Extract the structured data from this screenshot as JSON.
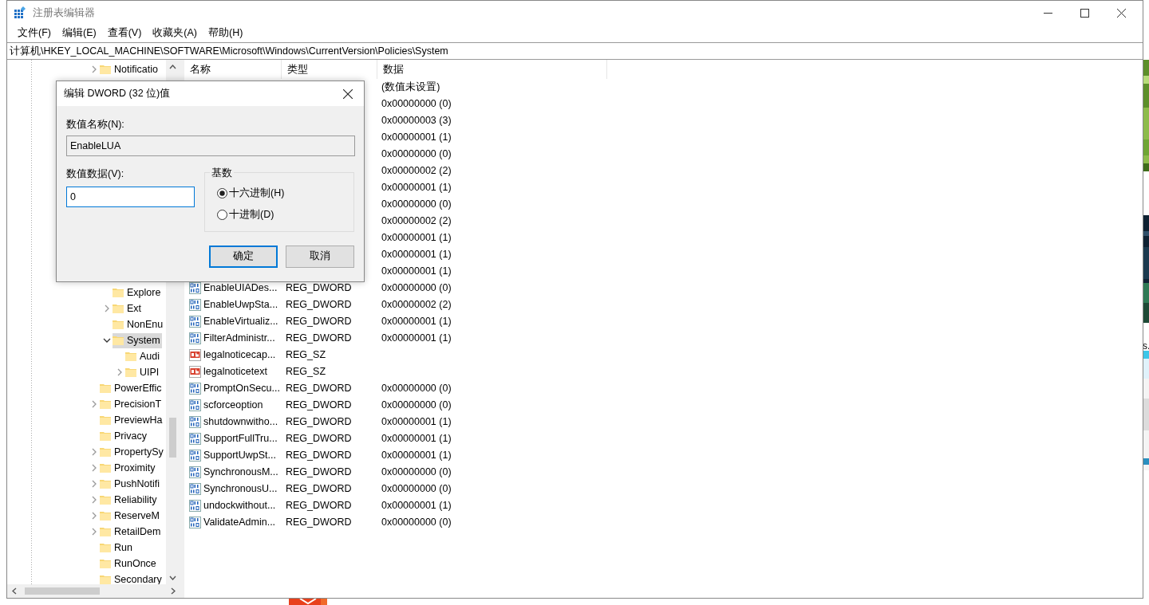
{
  "window": {
    "title": "注册表编辑器"
  },
  "menu": [
    "文件(F)",
    "编辑(E)",
    "查看(V)",
    "收藏夹(A)",
    "帮助(H)"
  ],
  "address": "计算机\\HKEY_LOCAL_MACHINE\\SOFTWARE\\Microsoft\\Windows\\CurrentVersion\\Policies\\System",
  "tree": [
    {
      "label": "Notificatio",
      "expanded": false,
      "selected": false
    },
    {
      "children": [
        {
          "label": "Explore",
          "selected": false
        },
        {
          "label": "Ext",
          "expanded": false,
          "selected": false
        },
        {
          "label": "NonEnu",
          "selected": false
        },
        {
          "label": "System",
          "expanded": true,
          "selected": true,
          "children": [
            {
              "label": "Audi",
              "selected": false
            },
            {
              "label": "UIPI",
              "expanded": false,
              "selected": false
            }
          ]
        }
      ]
    },
    {
      "label": "PowerEffic",
      "selected": false
    },
    {
      "label": "PrecisionT",
      "expanded": false,
      "selected": false
    },
    {
      "label": "PreviewHa",
      "selected": false
    },
    {
      "label": "Privacy",
      "selected": false
    },
    {
      "label": "PropertySy",
      "expanded": false,
      "selected": false
    },
    {
      "label": "Proximity",
      "expanded": false,
      "selected": false
    },
    {
      "label": "PushNotifi",
      "expanded": false,
      "selected": false
    },
    {
      "label": "Reliability",
      "expanded": false,
      "selected": false
    },
    {
      "label": "ReserveM",
      "expanded": false,
      "selected": false
    },
    {
      "label": "RetailDem",
      "expanded": false,
      "selected": false
    },
    {
      "label": "Run",
      "selected": false
    },
    {
      "label": "RunOnce",
      "selected": false
    },
    {
      "label": "Secondary",
      "selected": false
    }
  ],
  "columns": [
    "名称",
    "类型",
    "数据"
  ],
  "rows": [
    {
      "data": "(数值未设置)"
    },
    {
      "data": "0x00000000 (0)"
    },
    {
      "data": "0x00000003 (3)"
    },
    {
      "data": "0x00000001 (1)"
    },
    {
      "data": "0x00000000 (0)"
    },
    {
      "data": "0x00000002 (2)"
    },
    {
      "data": "0x00000001 (1)"
    },
    {
      "data": "0x00000000 (0)"
    },
    {
      "data": "0x00000002 (2)"
    },
    {
      "data": "0x00000001 (1)"
    },
    {
      "data": "0x00000001 (1)"
    },
    {
      "data": "0x00000001 (1)"
    },
    {
      "kind": "dword",
      "name": "EnableUIADes...",
      "type": "REG_DWORD",
      "data": "0x00000000 (0)"
    },
    {
      "kind": "dword",
      "name": "EnableUwpSta...",
      "type": "REG_DWORD",
      "data": "0x00000002 (2)"
    },
    {
      "kind": "dword",
      "name": "EnableVirtualiz...",
      "type": "REG_DWORD",
      "data": "0x00000001 (1)"
    },
    {
      "kind": "dword",
      "name": "FilterAdministr...",
      "type": "REG_DWORD",
      "data": "0x00000001 (1)"
    },
    {
      "kind": "sz",
      "name": "legalnoticecap...",
      "type": "REG_SZ"
    },
    {
      "kind": "sz",
      "name": "legalnoticetext",
      "type": "REG_SZ"
    },
    {
      "kind": "dword",
      "name": "PromptOnSecu...",
      "type": "REG_DWORD",
      "data": "0x00000000 (0)"
    },
    {
      "kind": "dword",
      "name": "scforceoption",
      "type": "REG_DWORD",
      "data": "0x00000000 (0)"
    },
    {
      "kind": "dword",
      "name": "shutdownwitho...",
      "type": "REG_DWORD",
      "data": "0x00000001 (1)"
    },
    {
      "kind": "dword",
      "name": "SupportFullTru...",
      "type": "REG_DWORD",
      "data": "0x00000001 (1)"
    },
    {
      "kind": "dword",
      "name": "SupportUwpSt...",
      "type": "REG_DWORD",
      "data": "0x00000001 (1)"
    },
    {
      "kind": "dword",
      "name": "SynchronousM...",
      "type": "REG_DWORD",
      "data": "0x00000000 (0)"
    },
    {
      "kind": "dword",
      "name": "SynchronousU...",
      "type": "REG_DWORD",
      "data": "0x00000000 (0)"
    },
    {
      "kind": "dword",
      "name": "undockwithout...",
      "type": "REG_DWORD",
      "data": "0x00000001 (1)"
    },
    {
      "kind": "dword",
      "name": "ValidateAdmin...",
      "type": "REG_DWORD",
      "data": "0x00000000 (0)"
    }
  ],
  "dialog": {
    "title": "编辑 DWORD (32 位)值",
    "name_label": "数值名称(N):",
    "name_value": "EnableLUA",
    "data_label": "数值数据(V):",
    "data_value": "0",
    "base_label": "基数",
    "bases": [
      {
        "label": "十六进制(H)",
        "selected": true
      },
      {
        "label": "十进制(D)",
        "selected": false
      }
    ],
    "buttons": [
      {
        "label": "确定",
        "default": true
      },
      {
        "label": "取消",
        "default": false
      }
    ]
  },
  "desktop": {
    "fragment_text": "s."
  }
}
